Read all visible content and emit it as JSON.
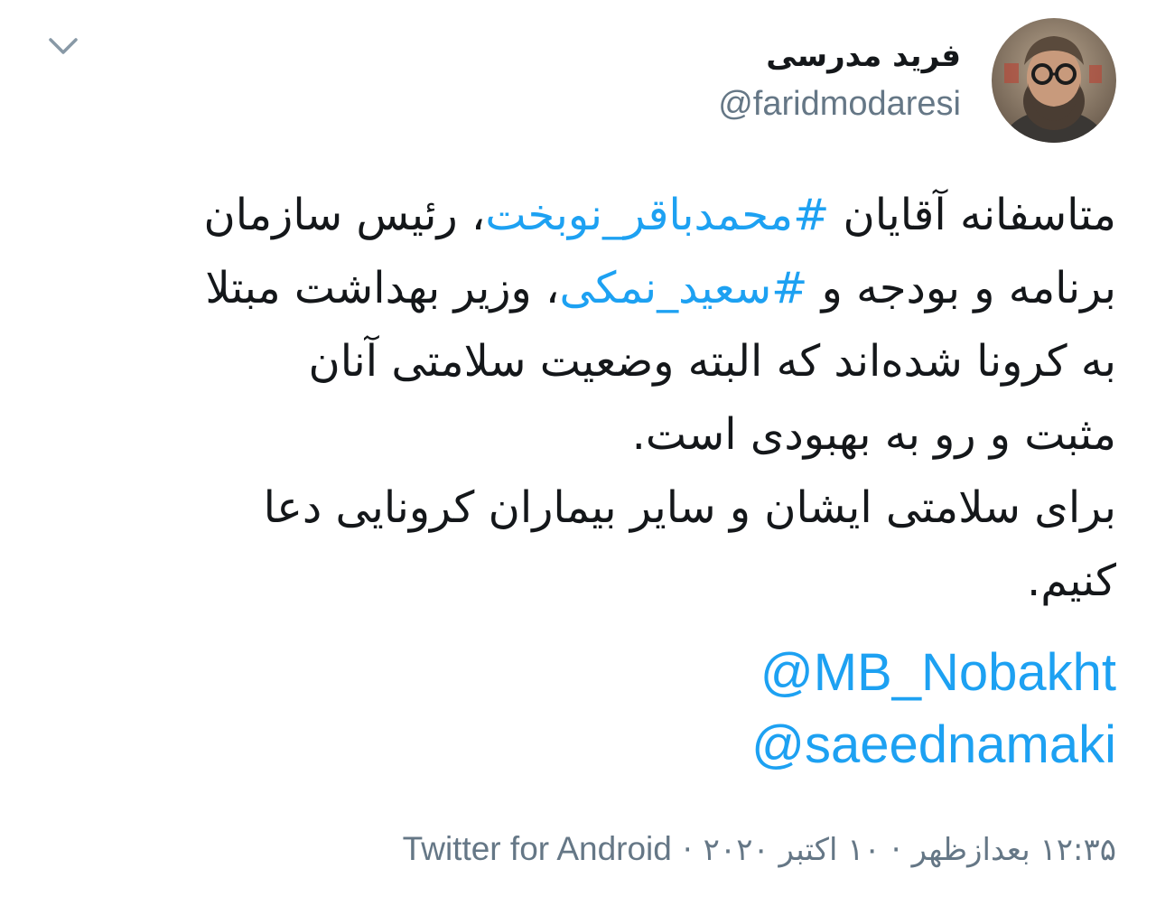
{
  "author": {
    "display_name": "فرید مدرسی",
    "handle": "@faridmodaresi"
  },
  "icons": {
    "menu": "chevron-down-icon",
    "avatar": "profile-photo"
  },
  "tweet": {
    "line1_prefix": "متاسفانه آقایان ",
    "hashtag1": "#محمدباقر_نوبخت",
    "line1_suffix": "، رئیس سازمان",
    "line2_prefix": "برنامه و بودجه و ",
    "hashtag2": "#سعید_نمکی",
    "line2_suffix": "، وزیر بهداشت مبتلا",
    "line3": "به کرونا شده‌اند که البته وضعیت سلامتی آنان",
    "line4": "مثبت و رو به بهبودی است.",
    "line5": "برای سلامتی ایشان و سایر بیماران کرونایی دعا",
    "line6": "کنیم.",
    "mention1": "@MB_Nobakht",
    "mention2": "@saeednamaki"
  },
  "meta": {
    "time": "۱۲:۳۵ بعدازظهر",
    "separator": "·",
    "date": "۱۰ اکتبر ۲۰۲۰",
    "source": "Twitter for Android"
  },
  "colors": {
    "link": "#1da1f2",
    "text": "#14171a",
    "secondary": "#657786"
  }
}
